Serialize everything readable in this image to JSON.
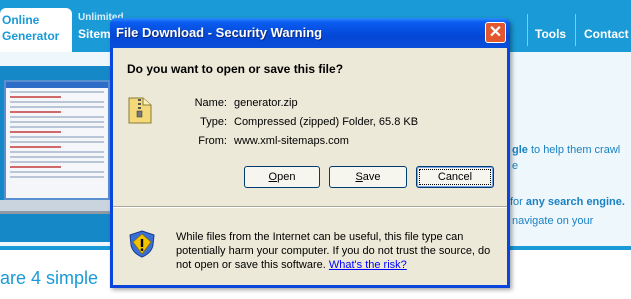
{
  "background": {
    "nav": {
      "tab_active_line1": "Online",
      "tab_active_line2": "Generator",
      "tab_sitemap_line1": "Unlimited",
      "tab_sitemap_line2": "Sitem",
      "tab_tools": "Tools",
      "tab_contact": "Contact"
    },
    "right_text_a": "gle",
    "right_text_a_rest": " to help them crawl",
    "right_text_b": "e",
    "right_text_c_pre": "for ",
    "right_text_c_bold": "any search engine.",
    "right_text_d": "navigate on your",
    "bottom_text": "are 4 simple"
  },
  "dialog": {
    "title": "File Download - Security Warning",
    "close_label": "✕",
    "question": "Do you want to open or save this file?",
    "fields": {
      "name_label": "Name:",
      "name_value": "generator.zip",
      "type_label": "Type:",
      "type_value": "Compressed (zipped) Folder, 65.8 KB",
      "from_label": "From:",
      "from_value": "www.xml-sitemaps.com"
    },
    "buttons": {
      "open_first": "O",
      "open_rest": "pen",
      "save_first": "S",
      "save_rest": "ave",
      "cancel": "Cancel"
    },
    "warning_text": "While files from the Internet can be useful, this file type can potentially harm your computer. If you do not trust the source, do not open or save this software.",
    "warning_link": "What's the risk?"
  },
  "colors": {
    "titlebar": "#0447d6",
    "dialog_bg": "#ece9d8",
    "site_blue": "#1a9ad6",
    "close_button": "#e2572d"
  },
  "icons": {
    "file": "zip-folder-icon",
    "warning": "shield-warning-icon",
    "close": "close-icon"
  }
}
